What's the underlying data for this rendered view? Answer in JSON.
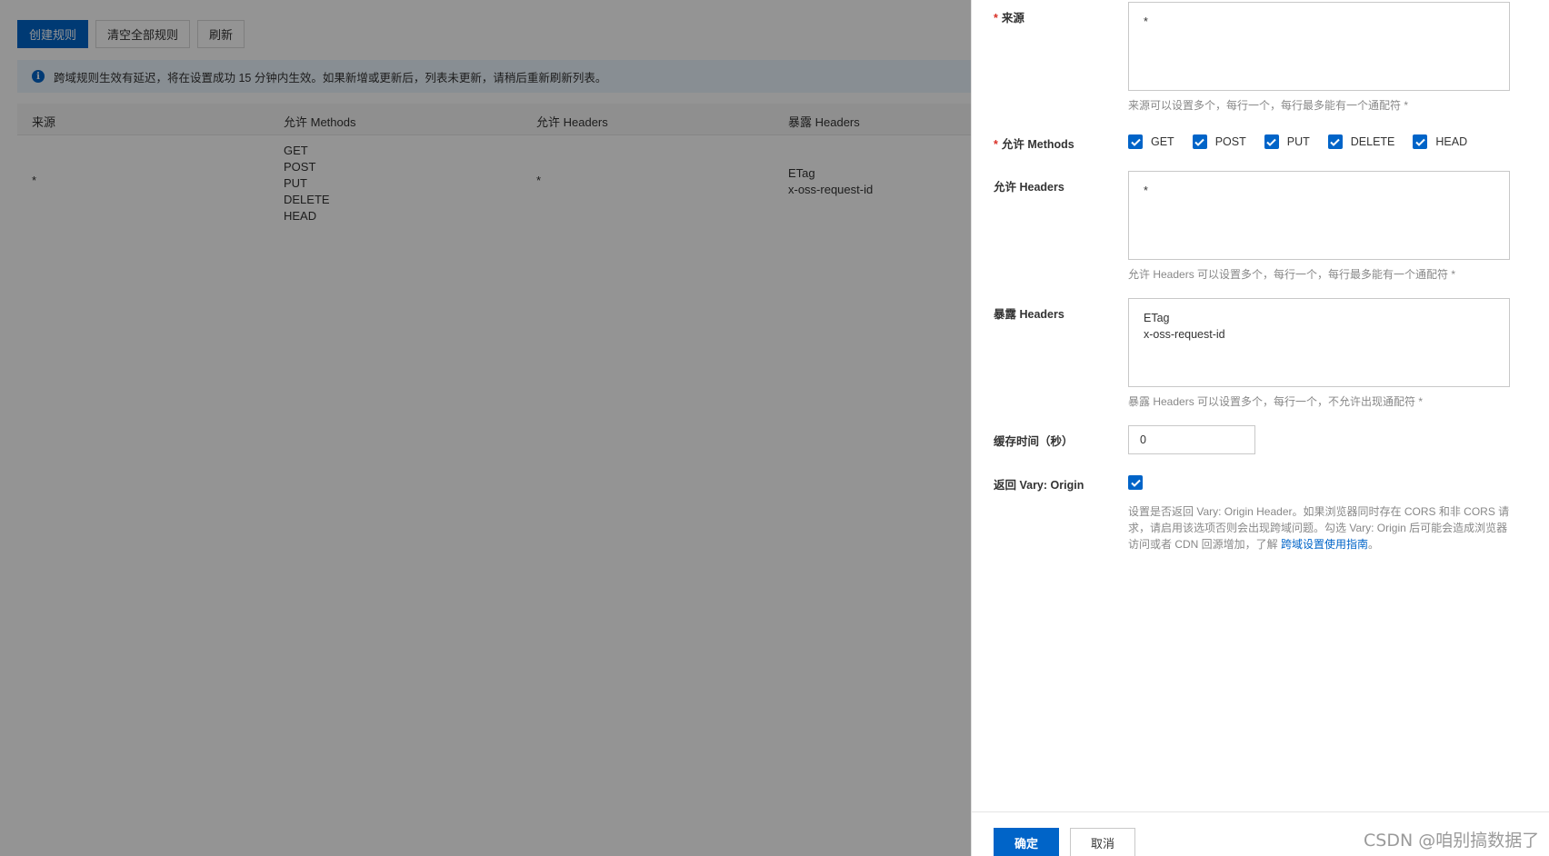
{
  "toolbar": {
    "create_label": "创建规则",
    "clear_label": "清空全部规则",
    "refresh_label": "刷新"
  },
  "notice": {
    "icon": "info-icon",
    "text": "跨域规则生效有延迟，将在设置成功 15 分钟内生效。如果新增或更新后，列表未更新，请稍后重新刷新列表。"
  },
  "table": {
    "columns": [
      "来源",
      "允许 Methods",
      "允许 Headers",
      "暴露 Headers"
    ],
    "rows": [
      {
        "origin": "*",
        "methods": "GET\nPOST\nPUT\nDELETE\nHEAD",
        "allow_headers": "*",
        "expose_headers": "ETag\nx-oss-request-id"
      }
    ]
  },
  "drawer": {
    "origin": {
      "label": "来源",
      "required_mark": "*",
      "value": "*",
      "hint": "来源可以设置多个，每行一个，每行最多能有一个通配符 *"
    },
    "methods": {
      "label": "允许 Methods",
      "required_mark": "*",
      "options": [
        {
          "label": "GET",
          "checked": true
        },
        {
          "label": "POST",
          "checked": true
        },
        {
          "label": "PUT",
          "checked": true
        },
        {
          "label": "DELETE",
          "checked": true
        },
        {
          "label": "HEAD",
          "checked": true
        }
      ]
    },
    "allow_headers": {
      "label": "允许 Headers",
      "value": "*",
      "hint": "允许 Headers 可以设置多个，每行一个，每行最多能有一个通配符 *"
    },
    "expose_headers": {
      "label": "暴露 Headers",
      "value": "ETag\nx-oss-request-id",
      "hint": "暴露 Headers 可以设置多个，每行一个，不允许出现通配符 *"
    },
    "cache": {
      "label": "缓存时间（秒）",
      "value": "0"
    },
    "vary": {
      "label": "返回 Vary: Origin",
      "checked": true,
      "hint_text": "设置是否返回 Vary: Origin Header。如果浏览器同时存在 CORS 和非 CORS 请求，请启用该选项否则会出现跨域问题。勾选 Vary: Origin 后可能会造成浏览器访问或者 CDN 回源增加，了解 ",
      "hint_link": "跨域设置使用指南",
      "hint_end": "。"
    },
    "footer": {
      "ok_label": "确定",
      "cancel_label": "取消"
    }
  },
  "watermark": "CSDN @咱别搞数据了",
  "colors": {
    "primary": "#0064c8",
    "required": "#d93026",
    "notice_bg": "#ebf4fd"
  }
}
